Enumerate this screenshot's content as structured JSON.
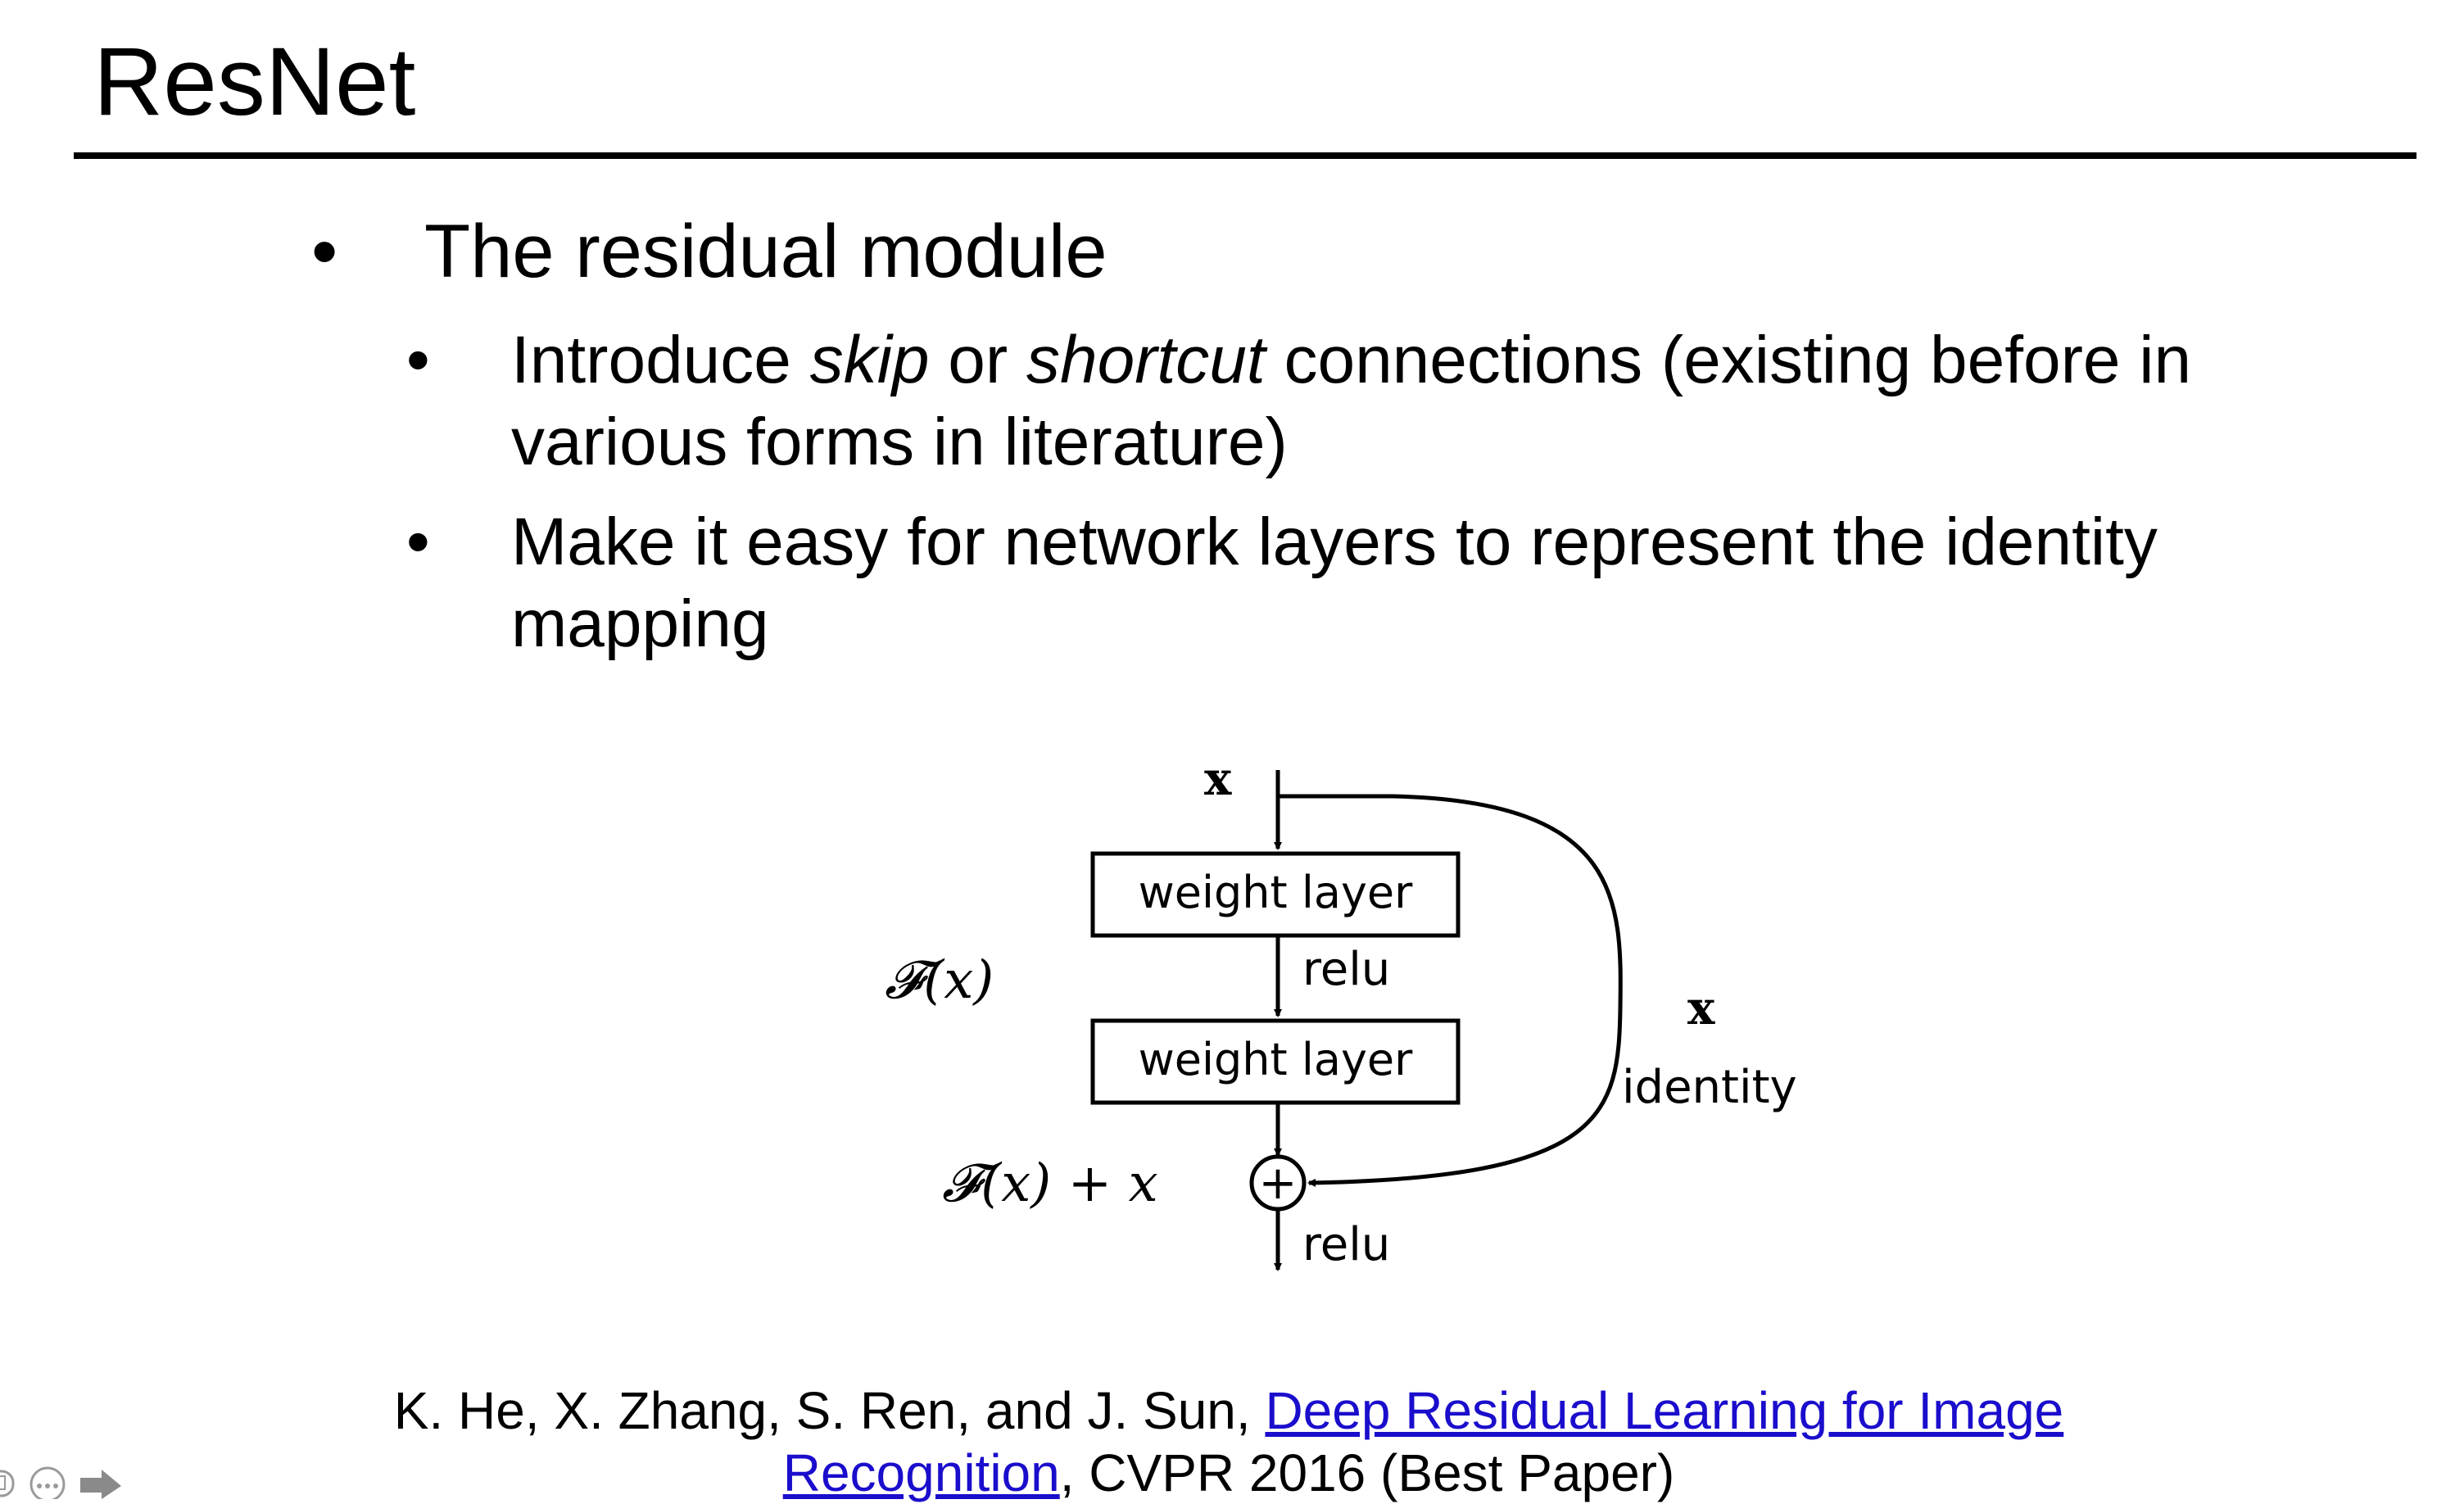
{
  "slide": {
    "title": "ResNet"
  },
  "bullets": {
    "main": "The residual module",
    "sub1_pre": "Introduce ",
    "sub1_em1": "skip",
    "sub1_mid": " or ",
    "sub1_em2": "shortcut",
    "sub1_post": " connections (existing before in various forms in literature)",
    "sub2": "Make it easy for network layers to represent the identity mapping",
    "marker": "•"
  },
  "diagram": {
    "input_label": "x",
    "box1_label": "weight layer",
    "relu1_label": "relu",
    "box2_label": "weight layer",
    "fx_label": "𝓕(x)",
    "sum_label": "𝓕(x) + x",
    "relu2_label": "relu",
    "shortcut_x_label": "x",
    "identity_label": "identity",
    "plus_symbol": "+"
  },
  "citation": {
    "authors": "K. He, X. Zhang, S. Ren, and J. Sun, ",
    "link_text": "Deep Residual Learning for Image Recognition",
    "venue": ", CVPR 2016 (Best Paper)",
    "link_color": "#1a0dcc"
  },
  "controls": {
    "icons": [
      "slide-icon",
      "more-icon",
      "next-arrow-icon"
    ]
  }
}
